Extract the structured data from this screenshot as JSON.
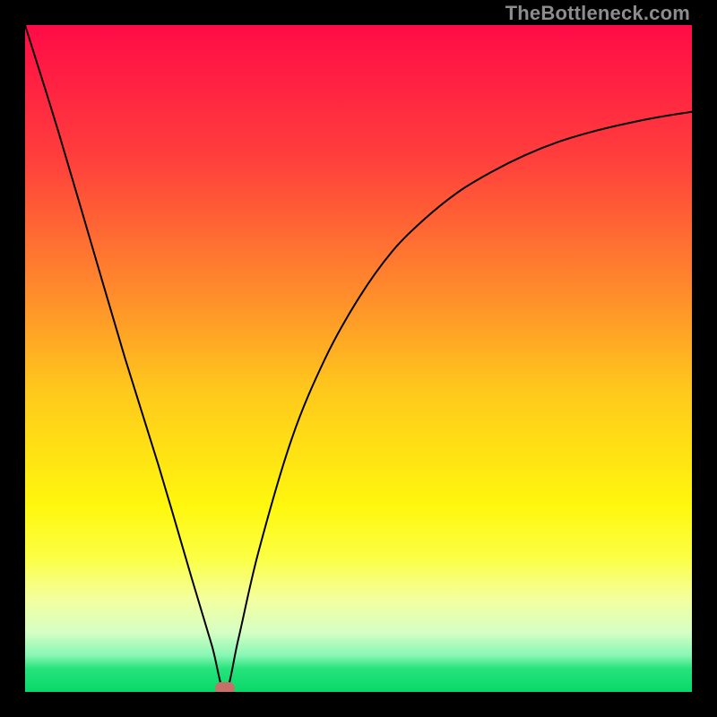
{
  "watermark": {
    "text": "TheBottleneck.com"
  },
  "chart_data": {
    "type": "line",
    "title": "",
    "xlabel": "",
    "ylabel": "",
    "xlim": [
      0,
      100
    ],
    "ylim": [
      0,
      100
    ],
    "grid": false,
    "legend": false,
    "background_gradient": {
      "stops": [
        {
          "pos": 0.0,
          "color": "#ff0b47"
        },
        {
          "pos": 0.2,
          "color": "#ff3f3c"
        },
        {
          "pos": 0.4,
          "color": "#ff8b2c"
        },
        {
          "pos": 0.55,
          "color": "#ffc91c"
        },
        {
          "pos": 0.72,
          "color": "#fff70d"
        },
        {
          "pos": 0.8,
          "color": "#fcff45"
        },
        {
          "pos": 0.86,
          "color": "#f4ff9e"
        },
        {
          "pos": 0.91,
          "color": "#d6ffc4"
        },
        {
          "pos": 0.945,
          "color": "#88f7b5"
        },
        {
          "pos": 0.965,
          "color": "#27e37c"
        },
        {
          "pos": 1.0,
          "color": "#07d968"
        }
      ]
    },
    "series": [
      {
        "name": "bottleneck-curve",
        "description": "V-shaped bottleneck curve with minimum near x≈30",
        "color": "#000000",
        "stroke_width": 2,
        "x": [
          0,
          5,
          10,
          15,
          20,
          25,
          28,
          30,
          32,
          35,
          40,
          45,
          50,
          55,
          60,
          65,
          70,
          75,
          80,
          85,
          90,
          95,
          100
        ],
        "values": [
          100,
          84,
          67,
          50,
          34,
          17,
          7,
          0,
          8,
          21,
          38,
          50,
          59,
          66,
          71,
          75,
          78,
          80.5,
          82.5,
          84,
          85.2,
          86.2,
          87
        ]
      }
    ],
    "annotations": [
      {
        "name": "min-marker",
        "x": 30,
        "y": 0.5,
        "shape": "pill",
        "color": "#c7706a"
      }
    ]
  }
}
